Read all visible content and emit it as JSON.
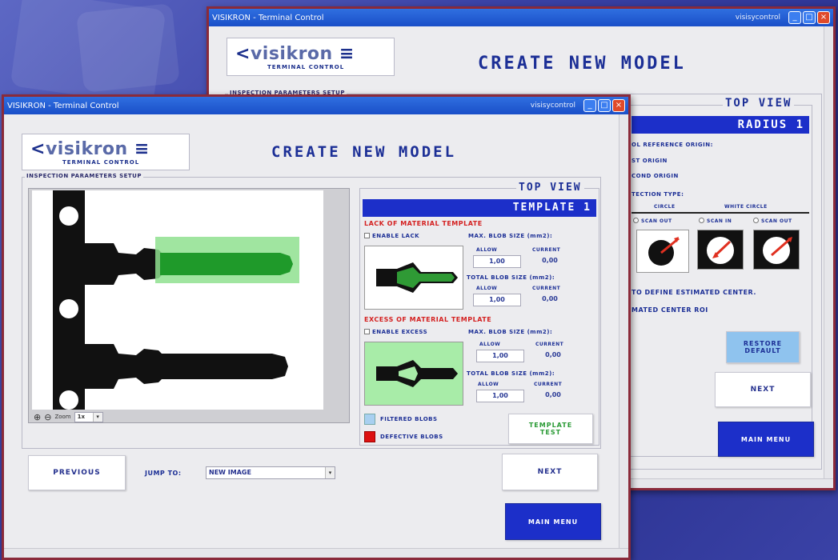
{
  "back_window": {
    "title": "VISIKRON - Terminal Control",
    "user": "visisycontrol",
    "logo_name": "visikron",
    "logo_sub": "TERMINAL CONTROL",
    "heading": "CREATE NEW MODEL",
    "group_label": "INSPECTION PARAMETERS SETUP",
    "view_title": "TOP VIEW",
    "view_bar": "RADIUS 1",
    "lines": [
      "OL REFERENCE ORIGIN:",
      "ST ORIGIN",
      "COND ORIGIN",
      "TECTION TYPE:"
    ],
    "circle_label": "CIRCLE",
    "white_circle_label": "WHITE CIRCLE",
    "radio_scan_out_1": "SCAN OUT",
    "radio_scan_in": "SCAN IN",
    "radio_scan_out_2": "SCAN OUT",
    "define_text": "TO DEFINE ESTIMATED CENTER.",
    "roi_text": "MATED CENTER ROI",
    "restore_button": "RESTORE DEFAULT",
    "next_button": "NEXT",
    "main_menu_button": "MAIN MENU"
  },
  "front_window": {
    "title": "VISIKRON - Terminal Control",
    "user": "visisycontrol",
    "logo_name": "visikron",
    "logo_sub": "TERMINAL CONTROL",
    "heading": "CREATE NEW MODEL",
    "group_label": "INSPECTION PARAMETERS SETUP",
    "view_title": "TOP VIEW",
    "view_bar": "TEMPLATE 1",
    "zoom_label": "Zoom",
    "zoom_value": "1x",
    "lack": {
      "title": "LACK OF MATERIAL TEMPLATE",
      "enable": "ENABLE LACK",
      "max_blob": "MAX. BLOB SIZE (mm2):",
      "allow": "ALLOW",
      "current": "CURRENT",
      "allow_value": "1,00",
      "current_value": "0,00",
      "total_blob": "TOTAL BLOB SIZE (mm2):",
      "allow2": "ALLOW",
      "current2": "CURRENT",
      "allow2_value": "1,00",
      "current2_value": "0,00"
    },
    "excess": {
      "title": "EXCESS OF MATERIAL TEMPLATE",
      "enable": "ENABLE EXCESS",
      "max_blob": "MAX. BLOB SIZE (mm2):",
      "allow": "ALLOW",
      "current": "CURRENT",
      "allow_value": "1,00",
      "current_value": "0,00",
      "total_blob": "TOTAL BLOB SIZE (mm2):",
      "allow2": "ALLOW",
      "current2": "CURRENT",
      "allow2_value": "1,00",
      "current2_value": "0,00"
    },
    "legend_filtered": "FILTERED BLOBS",
    "legend_defective": "DEFECTIVE BLOBS",
    "template_test_button": "TEMPLATE TEST",
    "previous_button": "PREVIOUS",
    "jump_to_label": "JUMP TO:",
    "jump_to_value": "NEW IMAGE",
    "next_button": "NEXT",
    "main_menu_button": "MAIN MENU"
  },
  "colors": {
    "accent_blue": "#1c2fc9",
    "heading_blue": "#1c2f96",
    "alert_red": "#d42020",
    "roi_green": "#8fe08f",
    "filtered_blue": "#a8d0f0",
    "defective_red": "#dd1111",
    "window_border": "#8a2a3a"
  }
}
